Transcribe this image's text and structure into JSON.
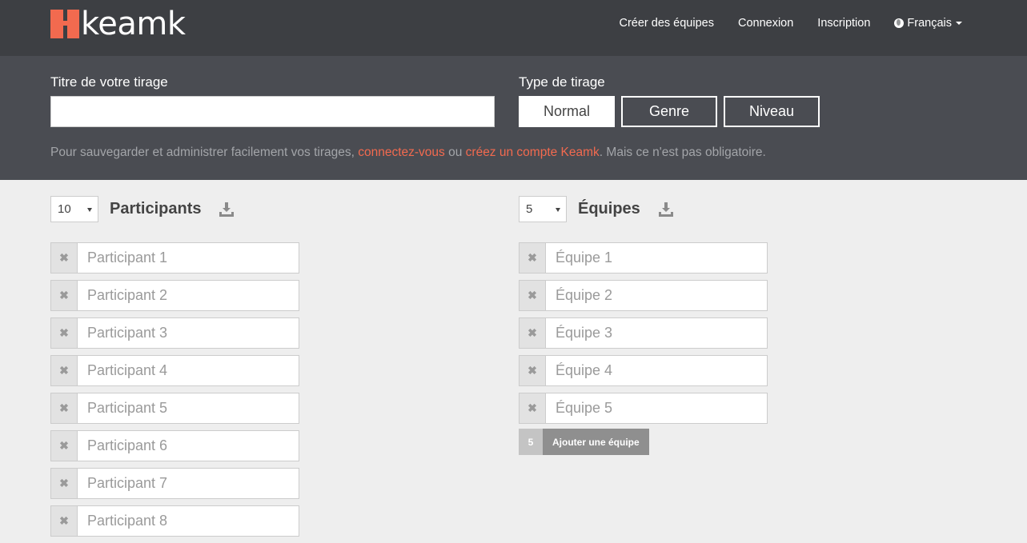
{
  "brand": {
    "name": "keamk",
    "accent_color": "#f26a4f"
  },
  "nav": {
    "items": [
      {
        "label": "Créer des équipes"
      },
      {
        "label": "Connexion"
      },
      {
        "label": "Inscription"
      }
    ],
    "language": {
      "label": "Français",
      "icon": "globe-icon"
    }
  },
  "settings": {
    "title_label": "Titre de votre tirage",
    "title_value": "",
    "type_label": "Type de tirage",
    "types": [
      {
        "label": "Normal",
        "active": true
      },
      {
        "label": "Genre",
        "active": false
      },
      {
        "label": "Niveau",
        "active": false
      }
    ],
    "notice": {
      "before": "Pour sauvegarder et administrer facilement vos tirages, ",
      "link1": "connectez-vous",
      "middle": " ou ",
      "link2": "créez un compte Keamk",
      "after": ". Mais ce n'est pas obligatoire."
    }
  },
  "participants": {
    "count": "10",
    "title": "Participants",
    "download_icon": "download-icon",
    "items": [
      {
        "placeholder": "Participant 1"
      },
      {
        "placeholder": "Participant 2"
      },
      {
        "placeholder": "Participant 3"
      },
      {
        "placeholder": "Participant 4"
      },
      {
        "placeholder": "Participant 5"
      },
      {
        "placeholder": "Participant 6"
      },
      {
        "placeholder": "Participant 7"
      },
      {
        "placeholder": "Participant 8"
      }
    ]
  },
  "teams": {
    "count": "5",
    "title": "Équipes",
    "download_icon": "download-icon",
    "items": [
      {
        "placeholder": "Équipe 1"
      },
      {
        "placeholder": "Équipe 2"
      },
      {
        "placeholder": "Équipe 3"
      },
      {
        "placeholder": "Équipe 4"
      },
      {
        "placeholder": "Équipe 5"
      }
    ],
    "add_count": "5",
    "add_label": "Ajouter une équipe"
  },
  "remove_glyph": "✖"
}
